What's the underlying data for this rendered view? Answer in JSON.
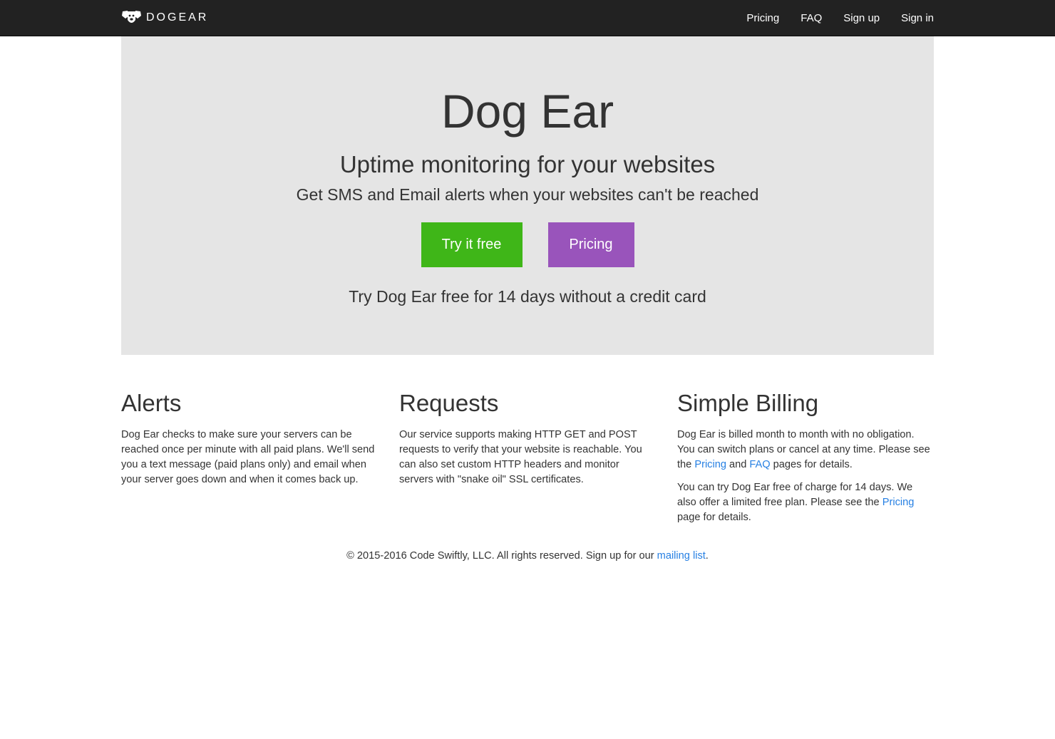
{
  "nav": {
    "brand": "DOGEAR",
    "items": [
      {
        "label": "Pricing"
      },
      {
        "label": "FAQ"
      },
      {
        "label": "Sign up"
      },
      {
        "label": "Sign in"
      }
    ]
  },
  "hero": {
    "title": "Dog Ear",
    "subtitle": "Uptime monitoring for your websites",
    "tagline": "Get SMS and Email alerts when your websites can't be reached",
    "try_button": "Try it free",
    "pricing_button": "Pricing",
    "note": "Try Dog Ear free for 14 days without a credit card"
  },
  "features": {
    "alerts": {
      "title": "Alerts",
      "body": "Dog Ear checks to make sure your servers can be reached once per minute with all paid plans. We'll send you a text message (paid plans only) and email when your server goes down and when it comes back up."
    },
    "requests": {
      "title": "Requests",
      "body": "Our service supports making HTTP GET and POST requests to verify that your website is reachable. You can also set custom HTTP headers and monitor servers with \"snake oil\" SSL certificates."
    },
    "billing": {
      "title": "Simple Billing",
      "p1_start": "Dog Ear is billed month to month with no obligation. You can switch plans or cancel at any time. Please see the ",
      "p1_link1": "Pricing",
      "p1_mid": " and ",
      "p1_link2": "FAQ",
      "p1_end": " pages for details.",
      "p2_start": "You can try Dog Ear free of charge for 14 days. We also offer a limited free plan. Please see the ",
      "p2_link": "Pricing",
      "p2_end": " page for details."
    }
  },
  "footer": {
    "text": "© 2015-2016 Code Swiftly, LLC. All rights reserved. Sign up for our ",
    "link": "mailing list",
    "end": "."
  },
  "colors": {
    "navbar": "#222222",
    "hero_bg": "#e5e5e5",
    "try_button": "#3fb618",
    "pricing_button": "#9954bb",
    "link": "#2780e3"
  },
  "icons": {
    "logo": "dog-face-icon"
  }
}
